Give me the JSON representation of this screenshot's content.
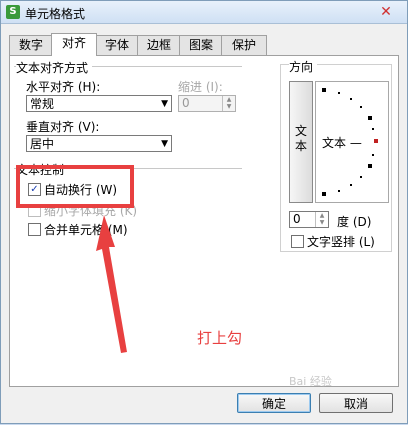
{
  "window": {
    "title": "单元格格式",
    "app_icon": "S",
    "close_glyph": "✕"
  },
  "tabs": [
    {
      "label": "数字",
      "active": false
    },
    {
      "label": "对齐",
      "active": true
    },
    {
      "label": "字体",
      "active": false
    },
    {
      "label": "边框",
      "active": false
    },
    {
      "label": "图案",
      "active": false
    },
    {
      "label": "保护",
      "active": false
    }
  ],
  "alignment": {
    "section_title": "文本对齐方式",
    "horizontal_label": "水平对齐 (H):",
    "horizontal_value": "常规",
    "indent_label": "缩进 (I):",
    "indent_value": "0",
    "vertical_label": "垂直对齐 (V):",
    "vertical_value": "居中"
  },
  "text_control": {
    "section_title": "文本控制",
    "wrap_label": "自动换行 (W)",
    "wrap_checked": true,
    "shrink_label": "缩小字体填充 (K)",
    "merge_label": "合并单元格 (M)"
  },
  "orientation": {
    "section_title": "方向",
    "vertical_text_label": "文本",
    "dial_text": "文本 —",
    "degrees_value": "0",
    "degrees_label": "度 (D)",
    "vertical_text_checkbox_label": "文字竖排 (L)"
  },
  "buttons": {
    "ok": "确定",
    "cancel": "取消"
  },
  "annotation": {
    "text": "打上勾",
    "color": "#e84040"
  },
  "watermark": "Bai 经验"
}
